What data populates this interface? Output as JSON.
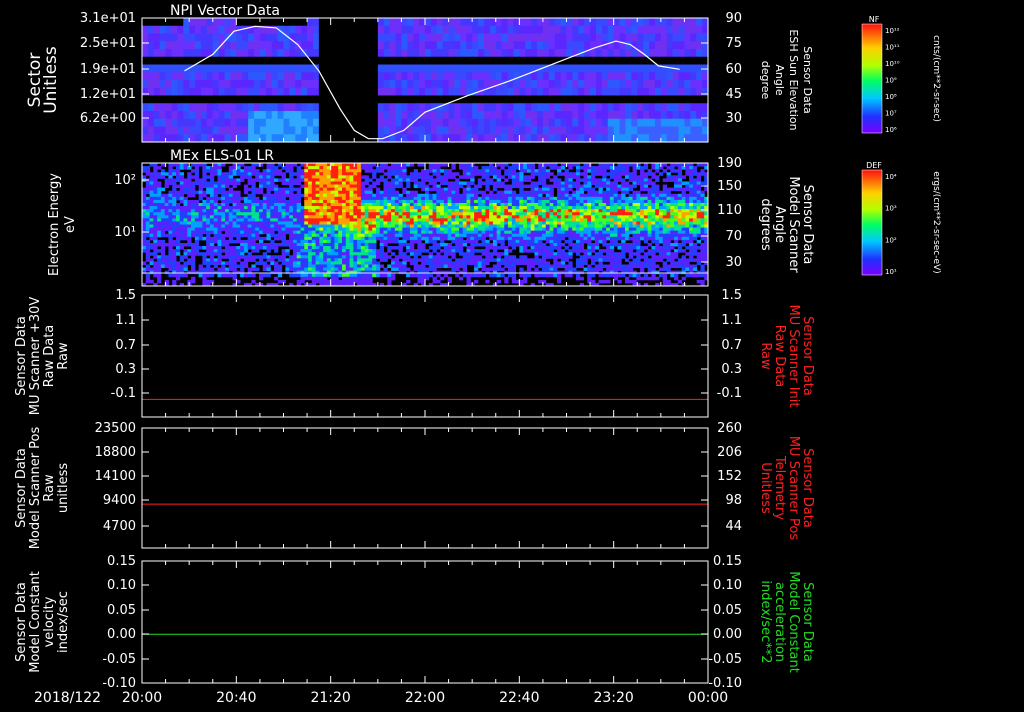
{
  "date_label": "2018/122",
  "time_ticks": [
    "20:00",
    "20:40",
    "21:20",
    "22:00",
    "22:40",
    "23:20",
    "00:00"
  ],
  "colorbars": [
    {
      "title": "NF",
      "unit": "cnts/(cm**2-sr-sec)",
      "labels": [
        "10¹²",
        "10¹¹",
        "10¹⁰",
        "10⁹",
        "10⁸",
        "10⁷",
        "10⁶"
      ]
    },
    {
      "title": "DEF",
      "unit": "ergs/(cm**2-sr-sec-eV)",
      "labels": [
        "10⁴",
        "10³",
        "10²",
        "10¹"
      ]
    }
  ],
  "chart_data": [
    {
      "type": "heatmap",
      "title": "NPI Vector Data",
      "ylabel": [
        "Sector",
        "Unitless"
      ],
      "y_ticks": [
        "3.1e+01",
        "2.5e+01",
        "1.9e+01",
        "1.2e+01",
        "6.2e+00"
      ],
      "y2label": [
        "Sensor Data",
        "ESH Sun Elevation",
        "Angle",
        "degree"
      ],
      "y2_ticks": [
        "90",
        "75",
        "60",
        "45",
        "30"
      ],
      "overlay_series": {
        "name": "ESH Sun Elevation Angle",
        "color": "#ffffff",
        "x_hours": [
          20.3,
          20.5,
          20.65,
          20.8,
          20.95,
          21.1,
          21.25,
          21.4,
          21.5,
          21.6,
          21.7,
          21.85,
          22.0,
          22.3,
          22.6,
          22.9,
          23.2,
          23.35,
          23.45,
          23.55,
          23.65,
          23.8
        ],
        "y_degrees": [
          58,
          68,
          82,
          85,
          84,
          74,
          58,
          35,
          22,
          17,
          17,
          22,
          33,
          43,
          52,
          62,
          72,
          76,
          74,
          68,
          61,
          59
        ]
      }
    },
    {
      "type": "heatmap",
      "title": "MEx ELS-01 LR",
      "ylabel": [
        "Electron Energy",
        "eV"
      ],
      "y_ticks": [
        "10²",
        "10¹"
      ],
      "y2label": [
        "Sensor Data",
        "Model Scanner",
        "Angle",
        "degrees"
      ],
      "y2_ticks": [
        "190",
        "150",
        "110",
        "70",
        "30"
      ]
    },
    {
      "type": "line",
      "ylabel": [
        "Sensor Data",
        "MU Scanner +30V",
        "Raw Data",
        "Raw"
      ],
      "y_ticks": [
        "1.5",
        "1.1",
        "0.7",
        "0.3",
        "-0.1"
      ],
      "ylim": [
        -0.3,
        1.5
      ],
      "y2label": [
        "Sensor Data",
        "MU Scanner Init",
        "Raw Data",
        "Raw"
      ],
      "y2label_color": "#ff2020",
      "y2_ticks": [
        "1.5",
        "1.1",
        "0.7",
        "0.3",
        "-0.1"
      ],
      "series": [
        {
          "color": "#ff2020",
          "x_hours": [
            20.0,
            24.0
          ],
          "y": [
            -0.04,
            -0.04
          ]
        }
      ]
    },
    {
      "type": "line",
      "ylabel": [
        "Sensor Data",
        "Model Scanner Pos",
        "Raw",
        "unitless"
      ],
      "y_ticks": [
        "23500",
        "18800",
        "14100",
        "9400",
        "4700"
      ],
      "ylim": [
        0,
        23500
      ],
      "y2label": [
        "Sensor Data",
        "MU Scanner Pos",
        "Telemetry",
        "Unitless"
      ],
      "y2label_color": "#ff2020",
      "y2_ticks": [
        "260",
        "206",
        "152",
        "98",
        "44"
      ],
      "series": [
        {
          "color": "#ff2020",
          "x_hours": [
            20.0,
            24.0
          ],
          "y": [
            8600,
            8600
          ]
        }
      ]
    },
    {
      "type": "line",
      "ylabel": [
        "Sensor Data",
        "Model Constant",
        "velocity",
        "index/sec"
      ],
      "y_ticks": [
        "0.15",
        "0.10",
        "0.05",
        "0.00",
        "-0.05",
        "-0.10"
      ],
      "ylim": [
        -0.1,
        0.15
      ],
      "y2label": [
        "Sensor Data",
        "Model Constant",
        "acceleration",
        "index/sec**2"
      ],
      "y2label_color": "#22dd22",
      "y2_ticks": [
        "0.15",
        "0.10",
        "0.05",
        "0.00",
        "-0.05",
        "-0.10"
      ],
      "series": [
        {
          "color": "#22dd22",
          "x_hours": [
            20.0,
            24.0
          ],
          "y": [
            0.0,
            0.0
          ]
        }
      ]
    }
  ]
}
